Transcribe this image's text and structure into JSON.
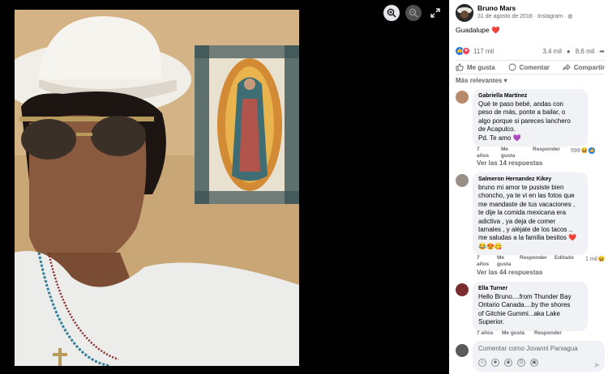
{
  "viewer": {
    "zoom_in_icon": "zoom-in-icon",
    "zoom_out_icon": "zoom-out-icon",
    "expand_icon": "expand-icon"
  },
  "post": {
    "author": "Bruno Mars",
    "date": "31 de agosto de 2018",
    "source": "Instagram",
    "caption": "Guadalupe",
    "caption_emoji": "❤️",
    "reactions_count": "117 mil",
    "comments_count": "3,4 mil",
    "shares_count": "8,6 mil"
  },
  "actions": {
    "like": "Me gusta",
    "comment": "Comentar",
    "share": "Compartir"
  },
  "sort_label": "Más relevantes",
  "comments": [
    {
      "name": "Gabriella Martínez",
      "lines": [
        "Qué te paso bebé, andas con",
        "peso de más, ponte a bailar, o",
        "algo porque si pareces lanchero",
        "de Acapulco.",
        "Pd. Te amo 💜"
      ],
      "age_1": "7",
      "age_2": "años",
      "like_1": "Me",
      "like_2": "gusta",
      "reply": "Responder",
      "edited": "",
      "reaction_count": "599",
      "more": "Ver las 14 respuestas"
    },
    {
      "name": "Salmeron Hernandez Kikey",
      "lines": [
        "bruno mi amor te pusiste bien",
        "choncho, ya te vi en las fotos que",
        "me mandaste de tus vacaciones ,",
        "te dije la comida mexicana era",
        "adictiva , ya deja de comer",
        "tamales , y aléjate de los tacos .,",
        "me saludas a la familia besitos ❤️",
        "😂😍😋"
      ],
      "age_1": "7",
      "age_2": "años",
      "like_1": "Me",
      "like_2": "gusta",
      "reply": "Responder",
      "edited": "Editado",
      "reaction_count": "1 mil",
      "more": "Ver las 44 respuestas"
    },
    {
      "name": "Ella Turner",
      "lines": [
        "Hello Bruno....from Thunder Bay",
        "Ontario Canada....by the shores",
        "of Gitchie Gummi...aka Lake",
        "Superior."
      ],
      "age": "7 años",
      "like": "Me gusta",
      "reply": "Responder"
    }
  ],
  "composer": {
    "placeholder": "Comentar como Jovanni Paniagua"
  }
}
